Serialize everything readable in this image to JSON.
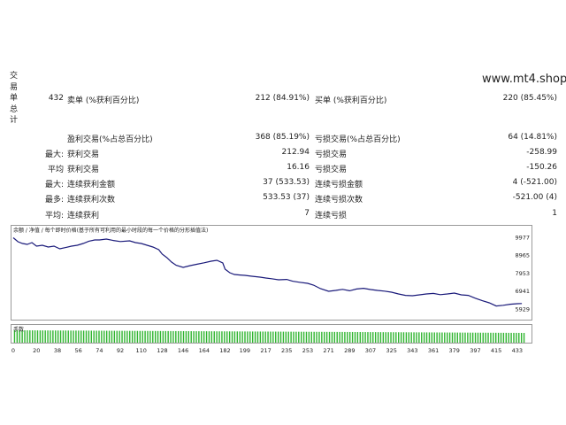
{
  "side_label": [
    "交",
    "易",
    "单",
    "总",
    "计"
  ],
  "site": "www.mt4.shop",
  "stats": {
    "total_trades": "432",
    "sell_label": "卖单 (%获利百分比)",
    "sell_value": "212 (84.91%)",
    "buy_label": "买单 (%获利百分比)",
    "buy_value": "220 (85.45%)",
    "profit_trades_label": "盈利交易(%占总百分比)",
    "profit_trades_value": "368 (85.19%)",
    "loss_trades_label": "亏损交易(%占总百分比)",
    "loss_trades_value": "64 (14.81%)",
    "largest_label": "最大:",
    "largest_profit_label": "获利交易",
    "largest_profit_value": "212.94",
    "largest_loss_label": "亏损交易",
    "largest_loss_value": "-258.99",
    "average_label": "平均",
    "avg_profit_label": "获利交易",
    "avg_profit_value": "16.16",
    "avg_loss_label": "亏损交易",
    "avg_loss_value": "-150.26",
    "max_label": "最大:",
    "max_consec_wins_label": "连续获利金额",
    "max_consec_wins_value": "37 (533.53)",
    "max_consec_losses_label": "连续亏损金额",
    "max_consec_losses_value": "4 (-521.00)",
    "maximal_label": "最多:",
    "max_consec_profit_label": "连续获利次数",
    "max_consec_profit_value": "533.53 (37)",
    "max_consec_loss_label": "连续亏损次数",
    "max_consec_loss_value": "-521.00 (4)",
    "avg2_label": "平均:",
    "avg_consec_wins_label": "连续获利",
    "avg_consec_wins_value": "7",
    "avg_consec_losses_label": "连续亏损",
    "avg_consec_losses_value": "1"
  },
  "chart_legend": "余额 / 净值 / 每个即时价格(基于所有可利用的最小时段的每一个价格的分形插值法)",
  "volume_label": "手数",
  "chart_data": {
    "type": "line",
    "line_color": "#1a1a7a",
    "volume_color": "#2fb52f",
    "y_ticks": [
      9977,
      8965,
      7953,
      6941,
      5929
    ],
    "ylim": [
      5600,
      10200
    ],
    "xlim": [
      0,
      440
    ],
    "x_ticks": [
      0,
      20,
      38,
      56,
      74,
      92,
      110,
      128,
      146,
      164,
      182,
      199,
      217,
      235,
      253,
      271,
      289,
      307,
      325,
      343,
      361,
      379,
      397,
      415,
      433
    ],
    "series": [
      {
        "x": [
          0,
          4,
          8,
          12,
          16,
          20,
          25,
          30,
          35,
          40,
          45,
          50,
          55,
          60,
          65,
          70,
          74,
          80,
          86,
          92,
          100,
          105,
          110,
          115,
          120,
          125,
          128,
          132,
          136,
          140,
          146,
          152,
          158,
          164,
          170,
          175,
          180,
          182,
          186,
          190,
          195,
          199,
          205,
          212,
          217,
          222,
          228,
          235,
          240,
          246,
          253,
          258,
          264,
          271,
          277,
          283,
          289,
          295,
          301,
          307,
          313,
          319,
          325,
          331,
          337,
          343,
          349,
          355,
          361,
          367,
          373,
          379,
          385,
          391,
          397,
          403,
          409,
          415,
          421,
          427,
          433,
          437
        ],
        "values": [
          9977,
          9750,
          9650,
          9600,
          9700,
          9500,
          9550,
          9450,
          9500,
          9350,
          9420,
          9500,
          9550,
          9650,
          9780,
          9850,
          9850,
          9900,
          9820,
          9760,
          9800,
          9700,
          9650,
          9550,
          9450,
          9300,
          9050,
          8850,
          8600,
          8420,
          8300,
          8400,
          8480,
          8560,
          8650,
          8700,
          8550,
          8200,
          8000,
          7900,
          7870,
          7850,
          7800,
          7750,
          7700,
          7660,
          7600,
          7620,
          7520,
          7460,
          7400,
          7300,
          7100,
          6950,
          7000,
          7060,
          6980,
          7080,
          7120,
          7050,
          7000,
          6960,
          6900,
          6800,
          6720,
          6700,
          6750,
          6800,
          6830,
          6760,
          6800,
          6850,
          6750,
          6720,
          6560,
          6420,
          6300,
          6120,
          6160,
          6220,
          6250,
          6260
        ]
      }
    ]
  }
}
